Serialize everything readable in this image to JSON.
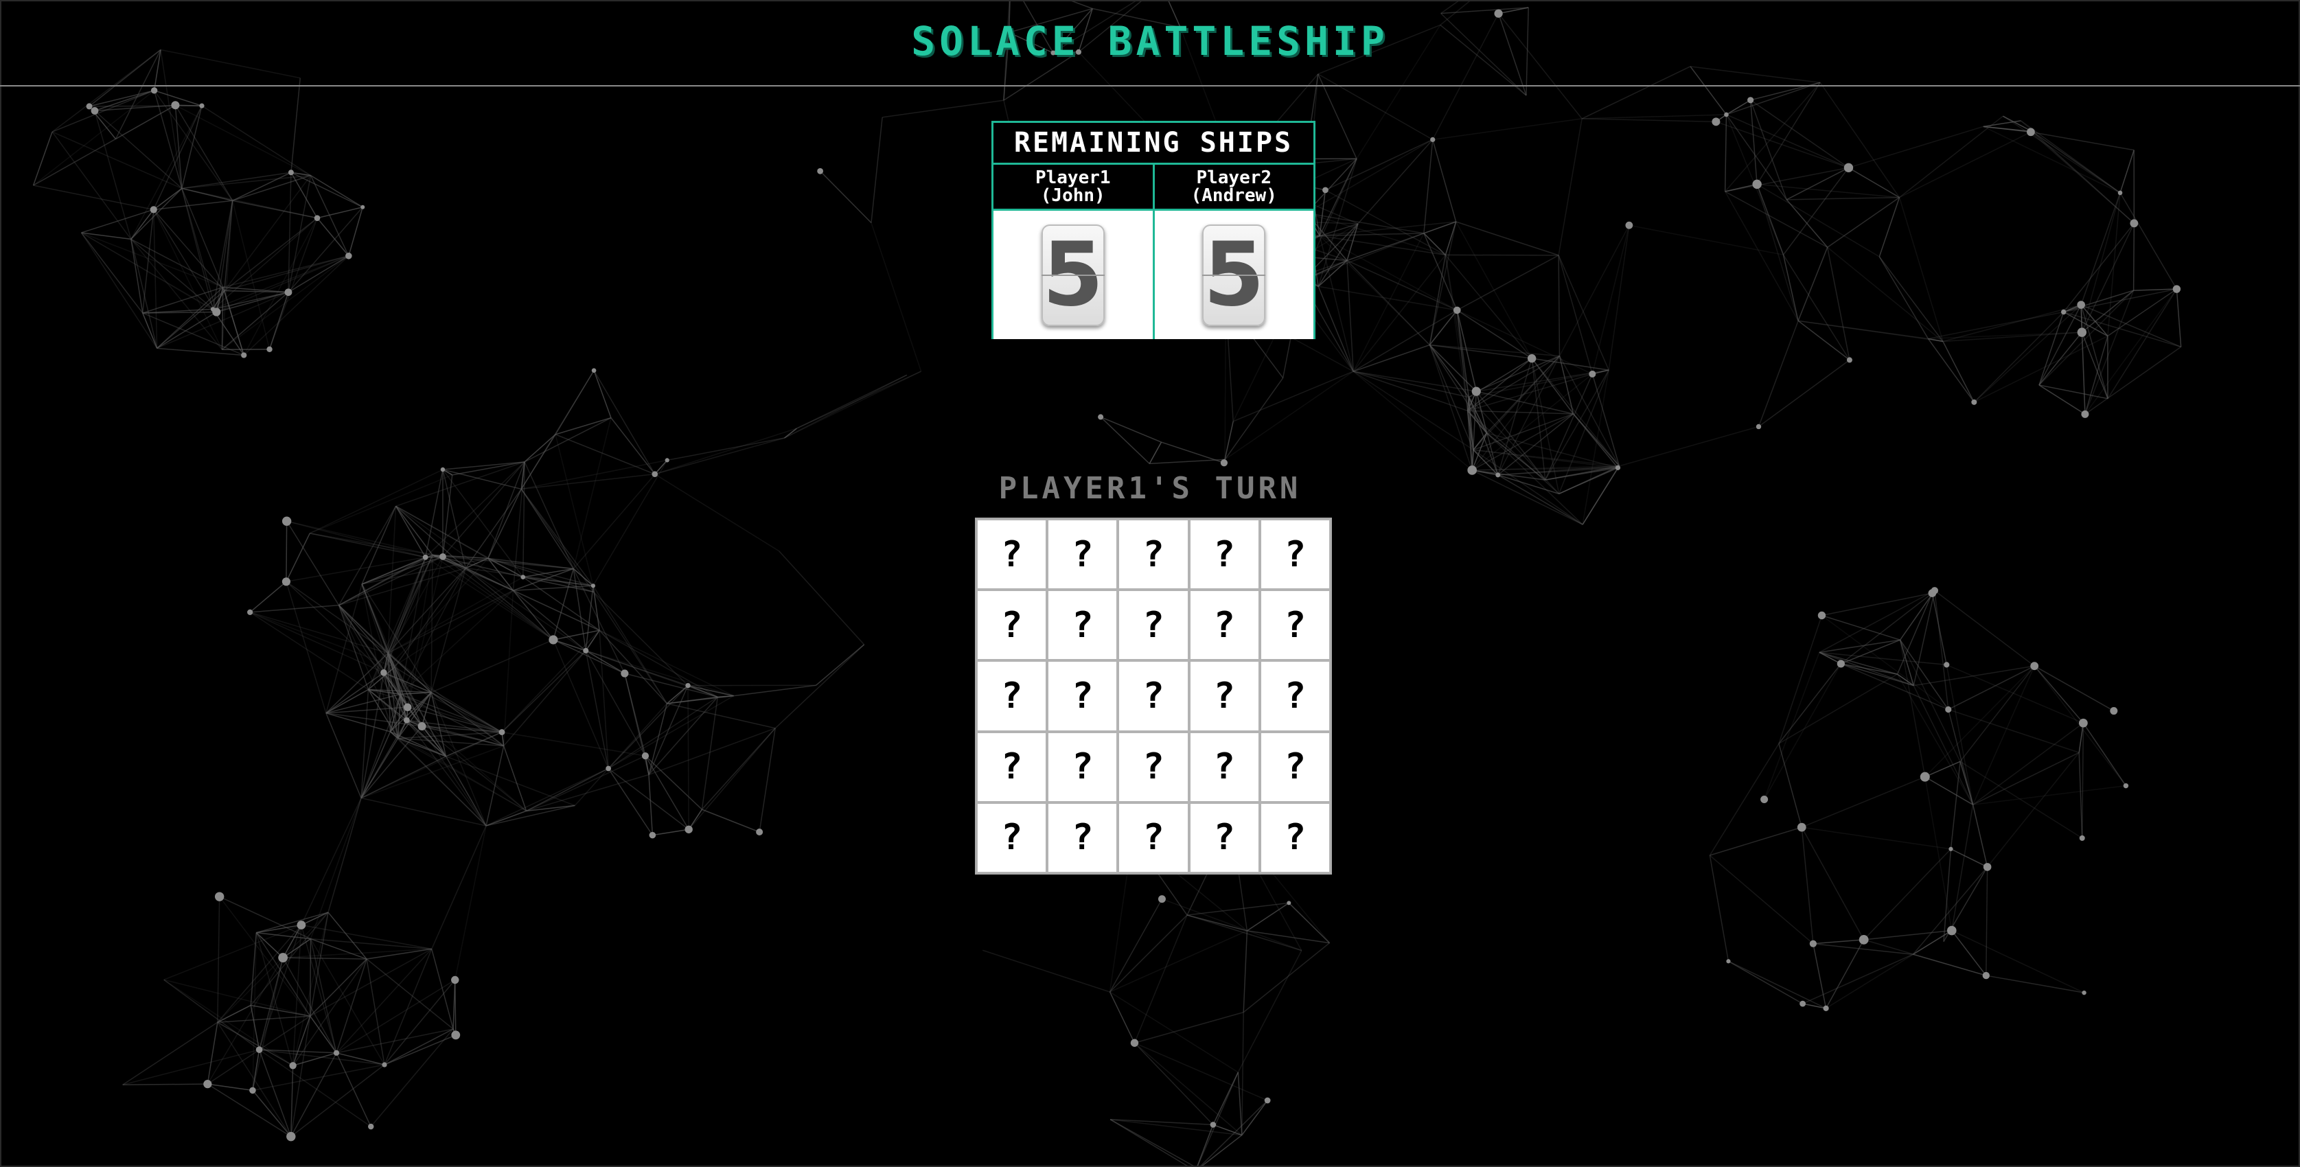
{
  "header": {
    "title": "SOLACE BATTLESHIP"
  },
  "scoreboard": {
    "title": "REMAINING SHIPS",
    "players": [
      {
        "label": "Player1",
        "name": "(John)",
        "remaining": "5"
      },
      {
        "label": "Player2",
        "name": "(Andrew)",
        "remaining": "5"
      }
    ]
  },
  "turn": {
    "text": "PLAYER1'S TURN"
  },
  "board": {
    "rows": 5,
    "cols": 5,
    "cells": [
      [
        "?",
        "?",
        "?",
        "?",
        "?"
      ],
      [
        "?",
        "?",
        "?",
        "?",
        "?"
      ],
      [
        "?",
        "?",
        "?",
        "?",
        "?"
      ],
      [
        "?",
        "?",
        "?",
        "?",
        "?"
      ],
      [
        "?",
        "?",
        "?",
        "?",
        "?"
      ]
    ]
  },
  "colors": {
    "accent": "#22c7a0",
    "background": "#000000",
    "turn_text": "#7b7b7b",
    "network_lines": "#5a5a5a",
    "network_nodes": "#8c8c8c"
  }
}
